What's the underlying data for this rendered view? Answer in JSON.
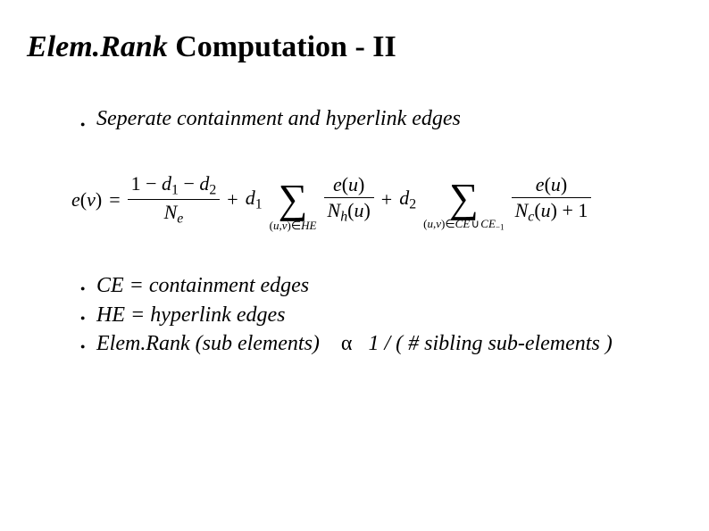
{
  "title": {
    "italic_part": "Elem.Rank",
    "rest": " Computation - II"
  },
  "intro_bullet": "Seperate containment and hyperlink edges",
  "formula": {
    "lhs": "e(v)",
    "eq": "=",
    "term1_num": "1 − d₁ − d₂",
    "term1_den": "Nₑ",
    "plus": "+",
    "coef1": "d₁",
    "sum1_sub": "(u,v)∈HE",
    "sum1_frac_num": "e(u)",
    "sum1_frac_den": "N_h(u)",
    "coef2": "d₂",
    "sum2_sub": "(u,v)∈CE ∪ CE⁻¹",
    "sum2_frac_num": "e(u)",
    "sum2_frac_den": "N_c(u) + 1"
  },
  "defs": {
    "ce": "CE = containment edges",
    "he": "HE = hyperlink edges",
    "er_left": "Elem.Rank (sub elements)",
    "alpha": "α",
    "er_right": "1 / ( # sibling sub-elements )"
  }
}
